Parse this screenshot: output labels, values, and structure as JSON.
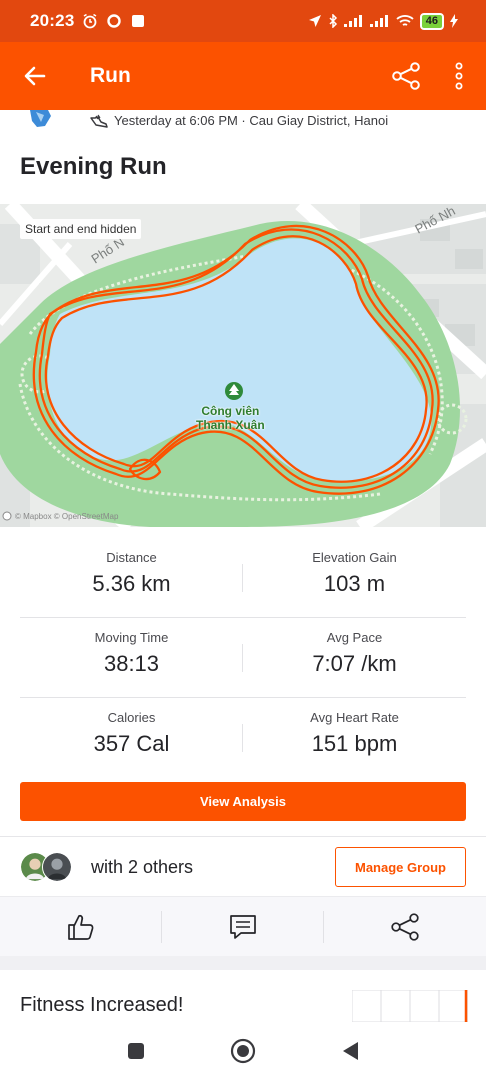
{
  "status_bar": {
    "time": "20:23",
    "battery": "46"
  },
  "app_bar": {
    "title": "Run"
  },
  "activity": {
    "meta": "Yesterday at 6:06 PM · Cau Giay District, Hanoi",
    "title": "Evening Run"
  },
  "map": {
    "hidden_label": "Start and end hidden",
    "park_name_line1": "Công viên",
    "park_name_line2": "Thanh Xuân",
    "street_label_1": "Phố N",
    "street_label_2": "Phố Nh",
    "copyright": "© Mapbox © OpenStreetMap"
  },
  "stats": [
    {
      "label": "Distance",
      "value": "5.36 km"
    },
    {
      "label": "Elevation Gain",
      "value": "103 m"
    },
    {
      "label": "Moving Time",
      "value": "38:13"
    },
    {
      "label": "Avg Pace",
      "value": "7:07 /km"
    },
    {
      "label": "Calories",
      "value": "357 Cal"
    },
    {
      "label": "Avg Heart Rate",
      "value": "151 bpm"
    }
  ],
  "buttons": {
    "view_analysis": "View Analysis",
    "manage_group": "Manage Group"
  },
  "group": {
    "text": "with 2 others"
  },
  "fitness": {
    "title": "Fitness Increased!"
  },
  "colors": {
    "brand": "#fc5200",
    "status_bar": "#e2480f",
    "route": "#fc5200",
    "water": "#bfe3f7",
    "park": "#9fd79f"
  },
  "icons": {
    "back": "arrow-left-icon",
    "share": "share-icon",
    "more": "more-vertical-icon",
    "shoe": "shoe-icon",
    "like": "thumbs-up-icon",
    "comment": "comment-icon",
    "nav_recents": "square-icon",
    "nav_home": "circle-icon",
    "nav_back": "triangle-left-icon"
  }
}
